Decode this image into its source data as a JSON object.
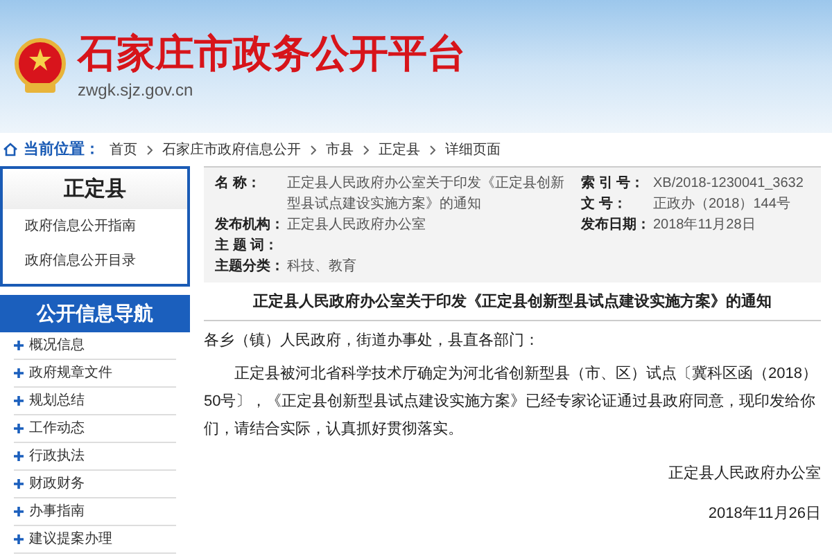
{
  "header": {
    "title": "石家庄市政务公开平台",
    "url": "zwgk.sjz.gov.cn"
  },
  "breadcrumb": {
    "label": "当前位置：",
    "items": [
      "首页",
      "石家庄市政府信息公开",
      "市县",
      "正定县",
      "详细页面"
    ]
  },
  "sidebar": {
    "county": {
      "title": "正定县",
      "links": [
        "政府信息公开指南",
        "政府信息公开目录"
      ]
    },
    "nav": {
      "title": "公开信息导航",
      "items": [
        "概况信息",
        "政府规章文件",
        "规划总结",
        "工作动态",
        "行政执法",
        "财政财务",
        "办事指南",
        "建议提案办理"
      ]
    }
  },
  "meta": {
    "left": [
      {
        "label": "名 称：",
        "value": "正定县人民政府办公室关于印发《正定县创新型县试点建设实施方案》的通知"
      },
      {
        "label": "发布机构：",
        "value": "正定县人民政府办公室"
      },
      {
        "label": "主 题 词："
      },
      {
        "label": "主题分类：",
        "value": "科技、教育"
      }
    ],
    "right": [
      {
        "label": "索 引 号：",
        "value": "XB/2018-1230041_3632"
      },
      {
        "label": "文 号：",
        "value": "正政办（2018）144号"
      },
      {
        "label": "发布日期：",
        "value": "2018年11月28日"
      }
    ]
  },
  "article": {
    "title": "正定县人民政府办公室关于印发《正定县创新型县试点建设实施方案》的通知",
    "salutation": "各乡（镇）人民政府，街道办事处，县直各部门：",
    "paragraphs": [
      "正定县被河北省科学技术厅确定为河北省创新型县（市、区）试点〔冀科区函（2018）50号〕，《正定县创新型县试点建设实施方案》已经专家论证通过县政府同意，现印发给你们，请结合实际，认真抓好贯彻落实。"
    ],
    "signature": "正定县人民政府办公室",
    "date": "2018年11月26日"
  }
}
